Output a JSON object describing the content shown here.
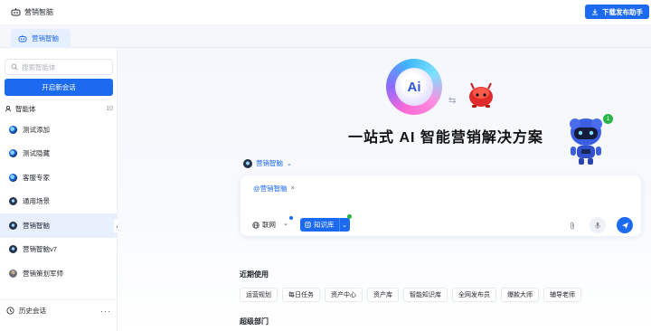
{
  "header": {
    "app_title": "营销智脑",
    "download_button": "下载发布助手"
  },
  "tabs": [
    {
      "label": "营销智脑"
    }
  ],
  "sidebar": {
    "search_placeholder": "搜索智能体",
    "new_chat_button": "开启新会话",
    "agents_section": {
      "title": "智能体",
      "count": "10"
    },
    "agents": [
      {
        "label": "测试添加",
        "icon": "agent-avatar-icon"
      },
      {
        "label": "测试隐藏",
        "icon": "agent-avatar-icon"
      },
      {
        "label": "客服专家",
        "icon": "agent-avatar-icon"
      },
      {
        "label": "通用场景",
        "icon": "agent-avatar-icon"
      },
      {
        "label": "营销智脑",
        "icon": "agent-avatar-icon",
        "active": true
      },
      {
        "label": "营销智脑v7",
        "icon": "agent-avatar-icon"
      },
      {
        "label": "营销策划军师",
        "icon": "person-avatar-icon"
      }
    ],
    "history_label": "历史会话"
  },
  "main": {
    "hero_title": "一站式 AI 智能营销解决方案",
    "logo_text": "Ai",
    "badge_count": "1",
    "agent_selector": "营销智脑",
    "input": {
      "tag": "@营销智脑",
      "web_label": "联网",
      "knowledge_base_label": "知识库"
    },
    "recent": {
      "title": "近期使用",
      "items": [
        "运营规划",
        "每日任务",
        "资产中心",
        "资产库",
        "智能知识库",
        "全网发布员",
        "爆款大师",
        "辅导老师"
      ]
    },
    "super_dept_title": "超级部门"
  },
  "colors": {
    "accent": "#1c6af0",
    "active_bg": "#e8f0fe",
    "online_dot": "#28b446"
  }
}
